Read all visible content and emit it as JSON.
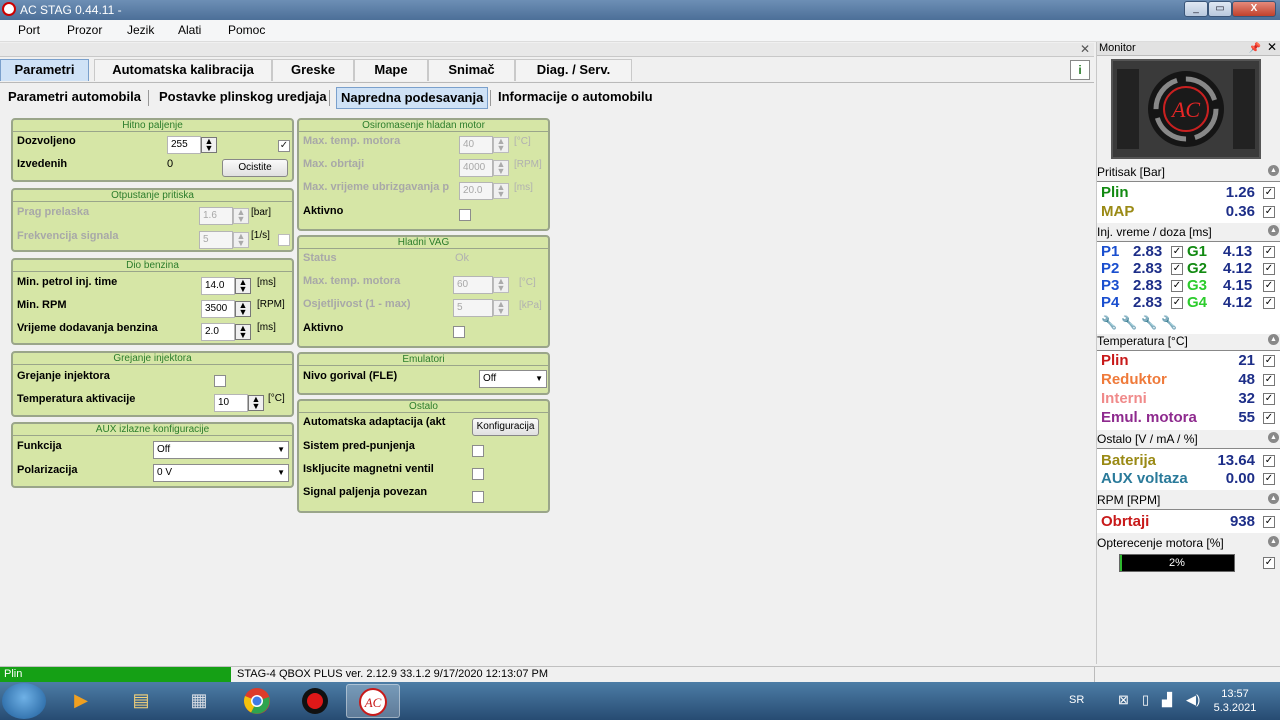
{
  "window": {
    "title": "AC STAG 0.44.11 -"
  },
  "menu": [
    "Port",
    "Prozor",
    "Jezik",
    "Alati",
    "Pomoc"
  ],
  "main_tabs": [
    "Parametri",
    "Automatska kalibracija",
    "Greske",
    "Mape",
    "Snimač",
    "Diag. / Serv."
  ],
  "sub_tabs": [
    "Parametri automobila",
    "Postavke plinskog uredjaja",
    "Napredna podesavanja",
    "Informacije o automobilu"
  ],
  "groups": {
    "hitno": {
      "title": "Hitno paljenje",
      "dozvoljeno_label": "Dozvoljeno",
      "dozvoljeno_value": "255",
      "izvedenih_label": "Izvedenih",
      "izvedenih_value": "0",
      "ocistite": "Ocistite"
    },
    "otpustanje": {
      "title": "Otpustanje pritiska",
      "prag_label": "Prag prelaska",
      "prag_value": "1.6",
      "prag_unit": "[bar]",
      "frekv_label": "Frekvencija signala",
      "frekv_value": "5",
      "frekv_unit": "[1/s]"
    },
    "dio": {
      "title": "Dio benzina",
      "min_petrol_label": "Min. petrol inj. time",
      "min_petrol_value": "14.0",
      "min_petrol_unit": "[ms]",
      "min_rpm_label": "Min. RPM",
      "min_rpm_value": "3500",
      "min_rpm_unit": "[RPM]",
      "vrijeme_label": "Vrijeme dodavanja benzina",
      "vrijeme_value": "2.0",
      "vrijeme_unit": "[ms]"
    },
    "grejanje": {
      "title": "Grejanje injektora",
      "grej_label": "Grejanje injektora",
      "temp_label": "Temperatura aktivacije",
      "temp_value": "10",
      "temp_unit": "[°C]"
    },
    "aux": {
      "title": "AUX izlazne konfiguracije",
      "funkcija_label": "Funkcija",
      "funkcija_value": "Off",
      "polarizacija_label": "Polarizacija",
      "polarizacija_value": "0 V"
    },
    "osiromasenje": {
      "title": "Osiromasenje hladan motor",
      "temp_label": "Max. temp. motora",
      "temp_value": "40",
      "temp_unit": "[°C]",
      "obrtaji_label": "Max. obrtaji",
      "obrtaji_value": "4000",
      "obrtaji_unit": "[RPM]",
      "vrijeme_label": "Max. vrijeme ubrizgavanja p",
      "vrijeme_value": "20.0",
      "vrijeme_unit": "[ms]",
      "aktivno_label": "Aktivno"
    },
    "vag": {
      "title": "Hladni VAG",
      "status_label": "Status",
      "status_value": "Ok",
      "temp_label": "Max. temp. motora",
      "temp_value": "60",
      "temp_unit": "[°C]",
      "osj_label": "Osjetljivost (1 - max)",
      "osj_value": "5",
      "osj_unit": "[kPa]",
      "aktivno_label": "Aktivno"
    },
    "emulatori": {
      "title": "Emulatori",
      "nivo_label": "Nivo gorival (FLE)",
      "nivo_value": "Off"
    },
    "ostalo": {
      "title": "Ostalo",
      "adapt_label": "Automatska adaptacija (akt",
      "konfig": "Konfiguracija",
      "sistem_label": "Sistem pred-punjenja",
      "iskljucite_label": "Iskljucite magnetni ventil",
      "signal_label": "Signal paljenja povezan"
    }
  },
  "monitor": {
    "title": "Monitor",
    "logo_text": "AC",
    "pritisak": {
      "header": "Pritisak [Bar]",
      "plin_label": "Plin",
      "plin_value": "1.26",
      "map_label": "MAP",
      "map_value": "0.36"
    },
    "inj": {
      "header": "Inj. vreme / doza [ms]",
      "rows": [
        {
          "p": "P1",
          "pv": "2.83",
          "g": "G1",
          "gv": "4.13"
        },
        {
          "p": "P2",
          "pv": "2.83",
          "g": "G2",
          "gv": "4.12"
        },
        {
          "p": "P3",
          "pv": "2.83",
          "g": "G3",
          "gv": "4.15"
        },
        {
          "p": "P4",
          "pv": "2.83",
          "g": "G4",
          "gv": "4.12"
        }
      ]
    },
    "temperatura": {
      "header": "Temperatura [°C]",
      "rows": [
        {
          "label": "Plin",
          "value": "21"
        },
        {
          "label": "Reduktor",
          "value": "48"
        },
        {
          "label": "Interni",
          "value": "32"
        },
        {
          "label": "Emul. motora",
          "value": "55"
        }
      ]
    },
    "ostalo": {
      "header": "Ostalo [V / mA / %]",
      "rows": [
        {
          "label": "Baterija",
          "value": "13.64"
        },
        {
          "label": "AUX voltaza",
          "value": "0.00"
        }
      ]
    },
    "rpm": {
      "header": "RPM [RPM]",
      "label": "Obrtaji",
      "value": "938"
    },
    "opterecenje": {
      "header": "Opterecenje motora [%]",
      "text": "2%",
      "fraction": 0.02
    }
  },
  "status": {
    "left": "Plin",
    "info": "STAG-4 QBOX PLUS  ver. 2.12.9  33.1.2  9/17/2020 12:13:07 PM"
  },
  "taskbar": {
    "lang": "SR",
    "time": "13:57",
    "date": "5.3.2021"
  },
  "colors": {
    "green_panel": "#d6e6a6",
    "tab_active": "#cfe2f6"
  }
}
